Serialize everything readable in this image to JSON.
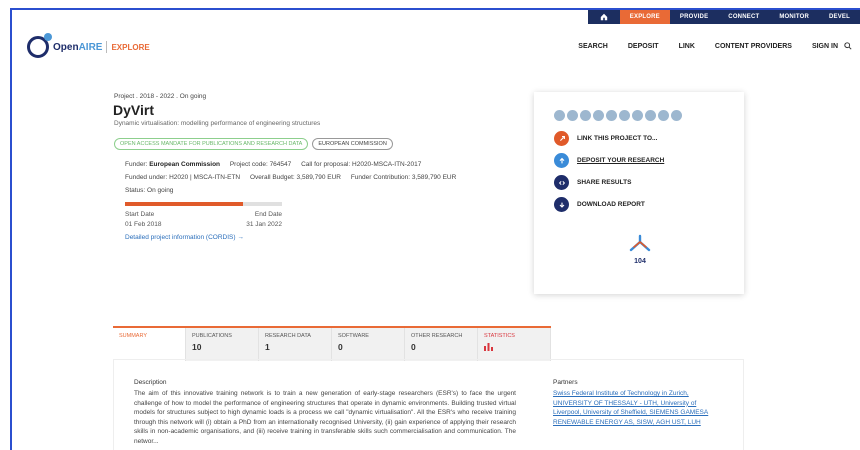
{
  "top_strip": {
    "items": [
      {
        "label": "EXPLORE",
        "active": true
      },
      {
        "label": "PROVIDE",
        "active": false
      },
      {
        "label": "CONNECT",
        "active": false
      },
      {
        "label": "MONITOR",
        "active": false
      },
      {
        "label": "DEVEL",
        "active": false
      }
    ]
  },
  "logo": {
    "brand_open": "Open",
    "brand_aire": "AIRE",
    "section": "EXPLORE"
  },
  "nav": {
    "items": [
      "SEARCH",
      "DEPOSIT",
      "LINK",
      "CONTENT PROVIDERS",
      "SIGN IN"
    ],
    "search_icon": "search-icon"
  },
  "project": {
    "meta": "Project . 2018 - 2022 . On going",
    "title": "DyVirt",
    "subtitle": "Dynamic virtualisation: modelling performance of engineering structures",
    "badges": [
      {
        "label": "OPEN ACCESS MANDATE FOR PUBLICATIONS AND RESEARCH DATA",
        "style": "green"
      },
      {
        "label": "EUROPEAN COMMISSION",
        "style": "grey"
      }
    ],
    "funder_label": "Funder:",
    "funder": "European Commission",
    "project_code": "Project code: 764547",
    "call": "Call for proposal: H2020-MSCA-ITN-2017",
    "funded_under": "Funded under: H2020 | MSCA-ITN-ETN",
    "overall_budget": "Overall Budget: 3,589,790 EUR",
    "funder_contribution": "Funder Contribution: 3,589,790 EUR",
    "status": "Status: On going",
    "progress_fraction": 0.75,
    "start_label": "Start Date",
    "start_date": "01 Feb 2018",
    "end_label": "End Date",
    "end_date": "31 Jan 2022",
    "detail_link": "Detailed project information (CORDIS) →"
  },
  "side_card": {
    "share_icons": [
      "share-icon-1",
      "share-icon-2",
      "share-icon-3",
      "share-icon-4",
      "share-icon-5",
      "share-icon-6",
      "share-icon-7",
      "share-icon-8",
      "share-icon-9",
      "share-icon-10"
    ],
    "actions": [
      {
        "label": "LINK THIS PROJECT TO...",
        "color": "#e05a2a",
        "icon": "link-icon",
        "underline": false
      },
      {
        "label": "DEPOSIT YOUR RESEARCH",
        "color": "#3a8bd8",
        "icon": "upload-icon",
        "underline": true
      },
      {
        "label": "SHARE RESULTS",
        "color": "#1e2d6a",
        "icon": "share-icon",
        "underline": false
      },
      {
        "label": "DOWNLOAD REPORT",
        "color": "#1e2d6a",
        "icon": "download-icon",
        "underline": false
      }
    ],
    "metric_value": "104"
  },
  "tabs": [
    {
      "label": "SUMMARY",
      "count": "",
      "active": true
    },
    {
      "label": "PUBLICATIONS",
      "count": "10",
      "active": false
    },
    {
      "label": "RESEARCH DATA",
      "count": "1",
      "active": false
    },
    {
      "label": "SOFTWARE",
      "count": "0",
      "active": false
    },
    {
      "label": "OTHER RESEARCH",
      "count": "0",
      "active": false
    },
    {
      "label": "STATISTICS",
      "count": "",
      "active": false
    }
  ],
  "description": {
    "heading": "Description",
    "text": "The aim of this innovative training network is to train a new generation of early-stage researchers (ESR's) to face the urgent challenge of how to model the performance of engineering structures that operate in dynamic environments. Building trusted virtual models for structures subject to high dynamic loads is a process we call \"dynamic virtualisation\". All the ESR's who receive training through this network will (i) obtain a PhD from an internationally recognised University, (ii) gain experience of applying their research skills in non-academic organisations, and (iii) receive training in transferable skills such commercialisation and communication. The networ..."
  },
  "partners": {
    "heading": "Partners",
    "text": "Swiss Federal Institute of Technology in Zurich, UNIVERSITY OF THESSALY - UTH, University of Liverpool, University of Sheffield, SIEMENS GAMESA RENEWABLE ENERGY AS, SISW, AGH UST, LUH"
  }
}
